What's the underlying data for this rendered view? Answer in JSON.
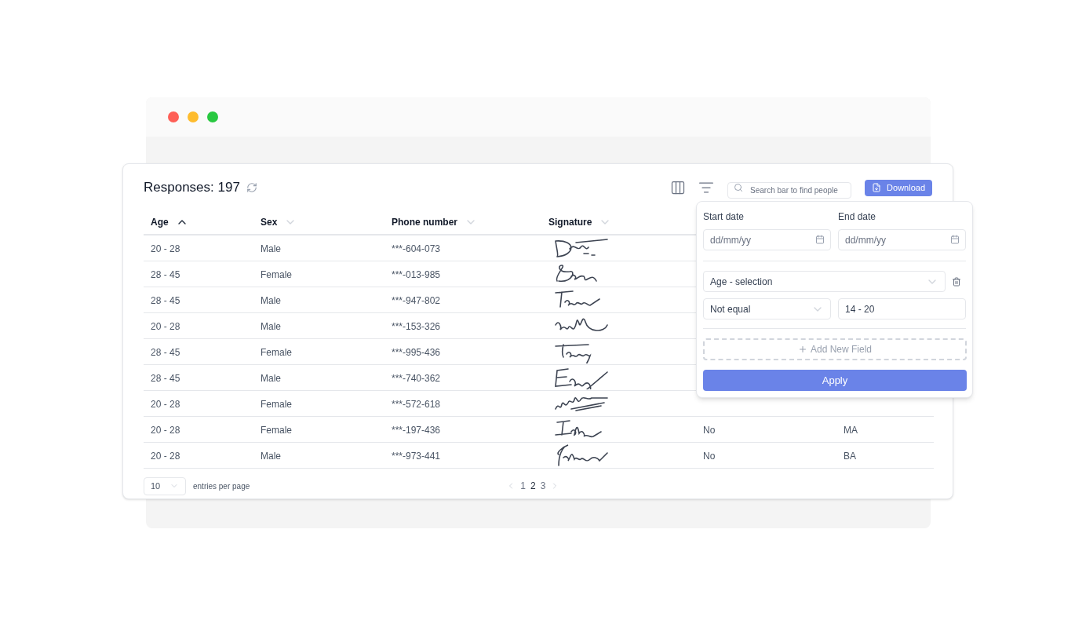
{
  "header": {
    "title": "Responses: 197",
    "search": {
      "placeholder": "Search bar to find people"
    },
    "download": "Download"
  },
  "table": {
    "columns": [
      {
        "label": "Age",
        "sorted": true
      },
      {
        "label": "Sex",
        "sorted": false
      },
      {
        "label": "Phone number",
        "sorted": false
      },
      {
        "label": "Signature",
        "sorted": false
      }
    ],
    "rows": [
      {
        "cells": [
          "20 - 28",
          "Male",
          "***-604-073"
        ]
      },
      {
        "cells": [
          "28 - 45",
          "Female",
          "***-013-985"
        ]
      },
      {
        "cells": [
          "28 - 45",
          "Male",
          "***-947-802"
        ]
      },
      {
        "cells": [
          "20 - 28",
          "Male",
          "***-153-326"
        ]
      },
      {
        "cells": [
          "28 - 45",
          "Female",
          "***-995-436"
        ]
      },
      {
        "cells": [
          "28 - 45",
          "Male",
          "***-740-362"
        ]
      },
      {
        "cells": [
          "20 - 28",
          "Female",
          "***-572-618"
        ]
      },
      {
        "cells": [
          "20 - 28",
          "Female",
          "***-197-436",
          "No",
          "MA"
        ]
      },
      {
        "cells": [
          "20 - 28",
          "Male",
          "***-973-441",
          "No",
          "BA"
        ]
      }
    ]
  },
  "footer": {
    "per_page": "10",
    "per_page_label": "entries per page",
    "pages": [
      {
        "label": "1",
        "selected": false
      },
      {
        "label": "2",
        "selected": true
      },
      {
        "label": "3",
        "selected": false
      }
    ]
  },
  "filter": {
    "start_label": "Start date",
    "start_placeholder": "dd/mm/yy",
    "end_label": "End date",
    "end_placeholder": "dd/mm/yy",
    "field": "Age - selection",
    "operator": "Not equal",
    "value": "14 - 20",
    "add": "Add New Field",
    "apply": "Apply"
  }
}
